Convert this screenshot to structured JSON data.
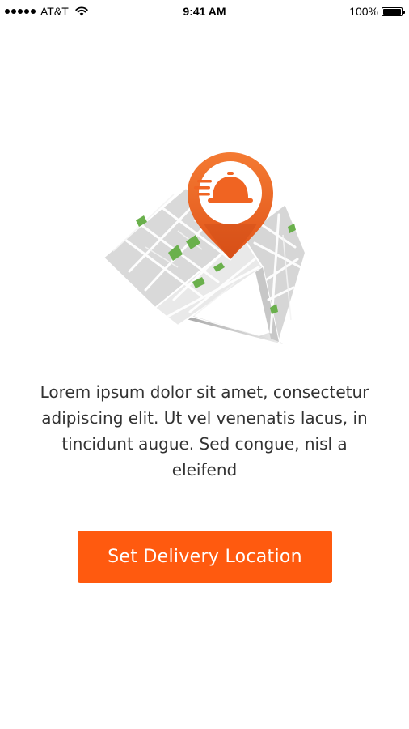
{
  "status_bar": {
    "carrier": "AT&T",
    "time": "9:41 AM",
    "battery_text": "100%",
    "battery_level": 1.0,
    "signal_icon": "signal-dots-icon",
    "wifi_icon": "wifi-icon",
    "battery_icon": "battery-icon"
  },
  "illustration": {
    "icon": "map-location-pin-icon",
    "pin_color": "#f06422",
    "map_green": "#6ab04c"
  },
  "content": {
    "description": "Lorem ipsum dolor sit amet, consectetur adipiscing elit. Ut vel venenatis lacus, in tincidunt augue. Sed congue, nisl a eleifend"
  },
  "actions": {
    "primary_label": "Set Delivery Location",
    "primary_color": "#ff5a0f"
  }
}
